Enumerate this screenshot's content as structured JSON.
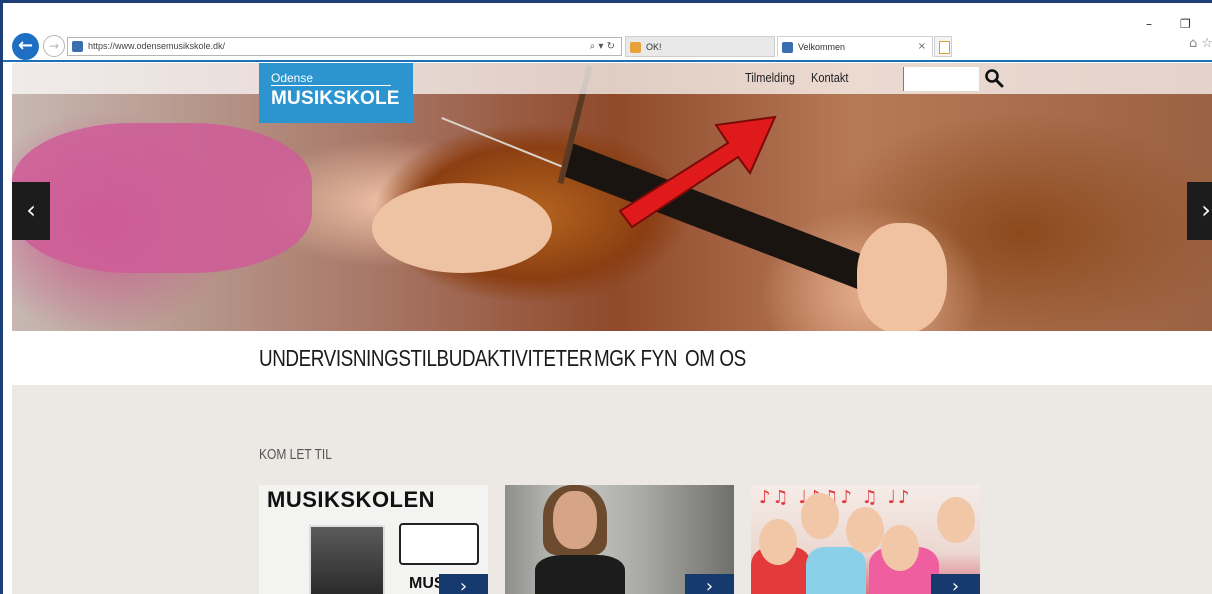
{
  "browser": {
    "address": "https://www.odensemusikskole.dk/",
    "address_icons": "⌕ ▾ ↻",
    "tabs": [
      {
        "label": "OK!"
      },
      {
        "label": "Velkommen"
      }
    ],
    "tab_close": "×",
    "window_controls": {
      "minimize": "–",
      "restore": "❐"
    },
    "toolbar_icons": "⌂ ☆"
  },
  "site": {
    "logo": {
      "line1": "Odense",
      "line2": "MUSIKSKOLE"
    },
    "top_links": [
      "Tilmelding",
      "Kontakt"
    ],
    "search": {
      "placeholder": ""
    },
    "hero": {
      "prev": "‹",
      "next": "›"
    },
    "nav": [
      "UNDERVISNINGSTILBUD",
      "AKTIVITETER",
      "MGK FYN",
      "OM OS"
    ],
    "section": {
      "title": "KOM LET TIL",
      "cards": [
        {
          "heading": "MUSIKSKOLEN",
          "subtext": "MUS",
          "arrow": "›"
        },
        {
          "arrow": "›"
        },
        {
          "notes": "♪♫ ♩♪♫♪ ♫ ♩♪",
          "arrow": "›"
        }
      ]
    }
  },
  "colors": {
    "brand_blue": "#2c95cf",
    "card_arrow": "#163a6e",
    "annotation_arrow": "#e01a1a"
  },
  "icons": {
    "back": "back-arrow-icon",
    "forward": "forward-arrow-icon",
    "search": "search-icon",
    "home": "home-icon",
    "favorites": "star-icon"
  }
}
